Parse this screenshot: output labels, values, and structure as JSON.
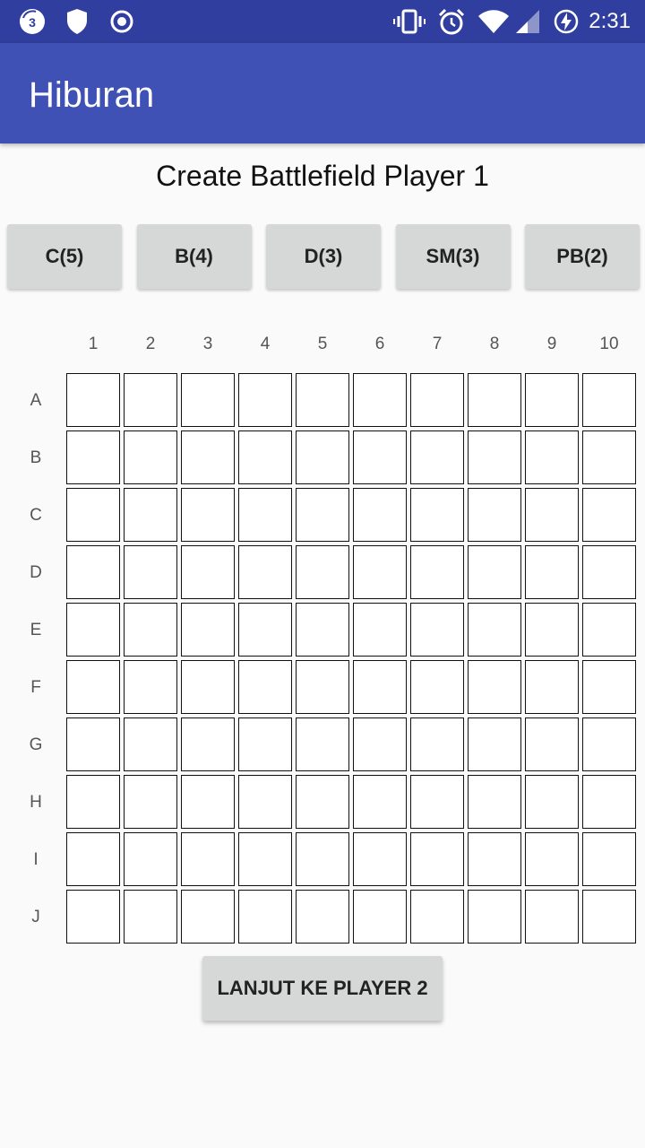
{
  "status_bar": {
    "time": "2:31",
    "notification_count": "3",
    "icons_left": [
      "notification-count-icon",
      "shield-icon",
      "record-icon"
    ],
    "icons_right": [
      "vibrate-icon",
      "alarm-icon",
      "wifi-icon",
      "signal-icon",
      "battery-charging-icon"
    ]
  },
  "app_bar": {
    "title": "Hiburan"
  },
  "heading": "Create Battlefield Player 1",
  "ship_buttons": [
    "C(5)",
    "B(4)",
    "D(3)",
    "SM(3)",
    "PB(2)"
  ],
  "grid": {
    "columns": [
      "1",
      "2",
      "3",
      "4",
      "5",
      "6",
      "7",
      "8",
      "9",
      "10"
    ],
    "rows": [
      "A",
      "B",
      "C",
      "D",
      "E",
      "F",
      "G",
      "H",
      "I",
      "J"
    ]
  },
  "next_button": "LANJUT KE PLAYER 2",
  "colors": {
    "status_bar": "#303f9f",
    "app_bar": "#3f51b5",
    "background": "#fafafa",
    "button": "#d6d7d7"
  }
}
